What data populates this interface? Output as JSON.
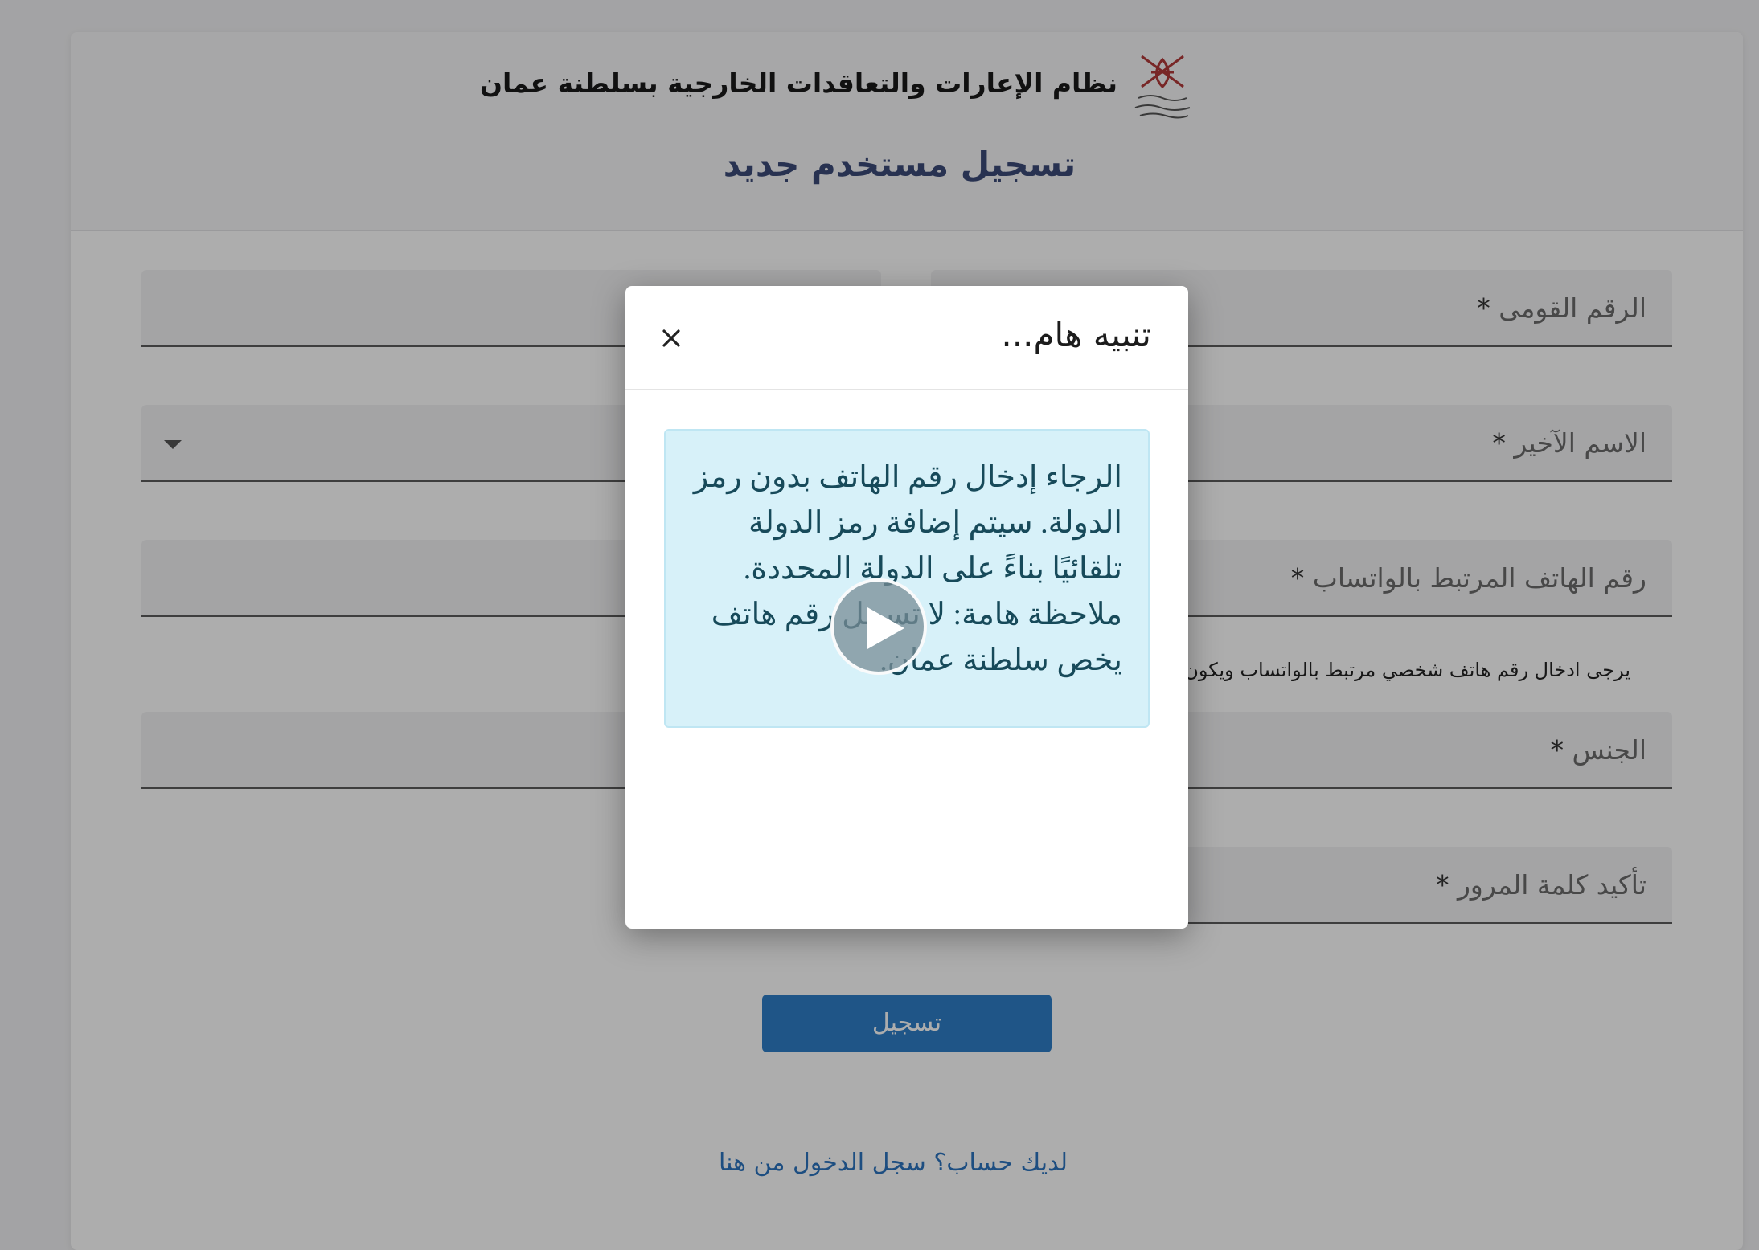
{
  "header": {
    "system_title": "نظام الإعارات والتعاقدات الخارجية بسلطنة عمان",
    "register_title": "تسجيل مستخدم جديد",
    "emblem_icon": "oman-khanjar-emblem-icon"
  },
  "form": {
    "fields": [
      {
        "label": "الرقم القومى",
        "required": "*"
      },
      {
        "label": "الاسم الآخير",
        "required": "*"
      },
      {
        "label": "رقم الهاتف المرتبط بالواتساب",
        "required": "*"
      },
      {
        "label": "الجنس",
        "required": "*"
      },
      {
        "label": "تأكيد كلمة المرور",
        "required": "*"
      }
    ],
    "phone_hint": "يرجى ادخال رقم هاتف شخصي مرتبط بالواتساب ويكون ف",
    "submit_label": "تسجيل",
    "login_link": "لديك حساب؟ سجل الدخول من هنا"
  },
  "modal": {
    "title": "تنبيه هام...",
    "message": "الرجاء إدخال رقم الهاتف بدون رمز الدولة. سيتم إضافة رمز الدولة تلقائيًا بناءً على الدولة المحددة. ملاحظة هامة: لا تسجل رقم هاتف يخص سلطنة عمان.",
    "close_icon": "close-icon",
    "play_icon": "play-icon"
  },
  "colors": {
    "primary": "#2f7ec8",
    "title_color": "#3b4a78",
    "alert_bg": "#d7f1f9",
    "alert_text": "#174a5a"
  }
}
